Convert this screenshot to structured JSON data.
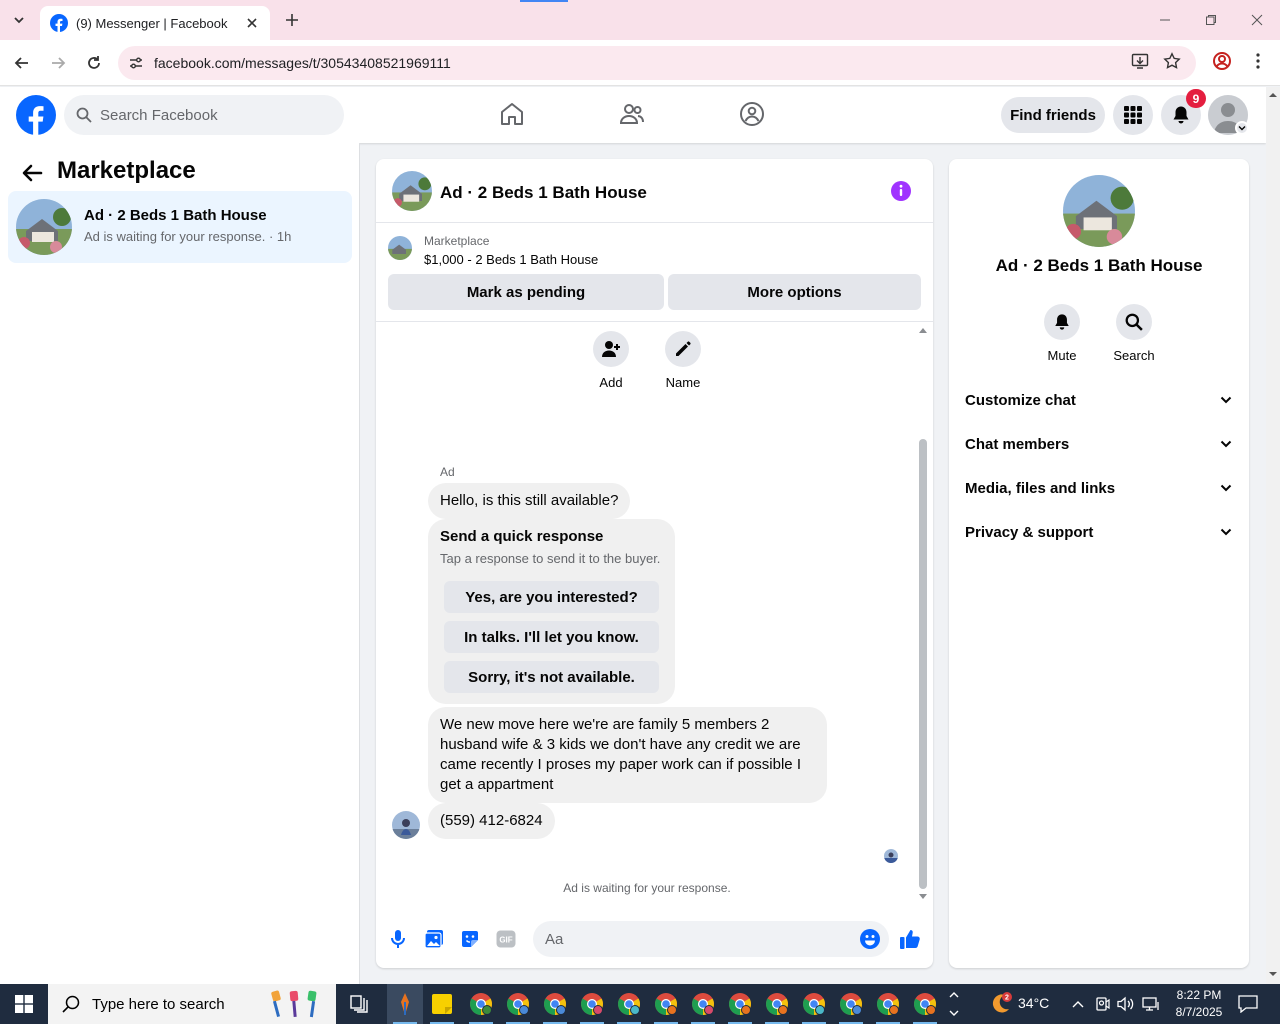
{
  "browser": {
    "tab_title": "(9) Messenger | Facebook",
    "url": "facebook.com/messages/t/30543408521969111"
  },
  "header": {
    "search_placeholder": "Search Facebook",
    "find_friends": "Find friends",
    "notification_count": "9",
    "brand_color": "#0866ff"
  },
  "sidebar": {
    "title": "Marketplace",
    "conversation": {
      "name": "Ad · 2 Beds 1 Bath House",
      "preview": "Ad is waiting for your response. · 1h"
    }
  },
  "chat": {
    "title": "Ad · 2 Beds 1 Bath House",
    "listing_source": "Marketplace",
    "listing_price": "$1,000 - 2 Beds 1 Bath House",
    "mark_pending": "Mark as pending",
    "more_options": "More options",
    "actions": [
      {
        "label": "Add",
        "icon": "add-person-icon"
      },
      {
        "label": "Name",
        "icon": "pencil-icon"
      }
    ],
    "sender_name": "Ad",
    "messages": {
      "first": "Hello, is this still available?",
      "quick_title": "Send a quick response",
      "quick_subtitle": "Tap a response to send it to the buyer.",
      "quick_replies": [
        "Yes, are you interested?",
        "In talks. I'll let you know.",
        "Sorry, it's not available."
      ],
      "long": "We new move here we're are family 5 members 2 husband wife & 3 kids we don't have any credit we are came recently I proses my paper work can if possible I get a appartment",
      "phone": "(559) 412-6824"
    },
    "waiting_text": "Ad is waiting for your response.",
    "composer_placeholder": "Aa",
    "accent_color": "#a033ff"
  },
  "info_panel": {
    "title": "Ad · 2 Beds 1 Bath House",
    "actions": [
      {
        "label": "Mute",
        "icon": "bell-icon"
      },
      {
        "label": "Search",
        "icon": "search-icon"
      }
    ],
    "sections": [
      "Customize chat",
      "Chat members",
      "Media, files and links",
      "Privacy & support"
    ]
  },
  "taskbar": {
    "search_placeholder": "Type here to search",
    "temperature": "34°C",
    "time": "8:22 PM",
    "date": "8/7/2025"
  }
}
